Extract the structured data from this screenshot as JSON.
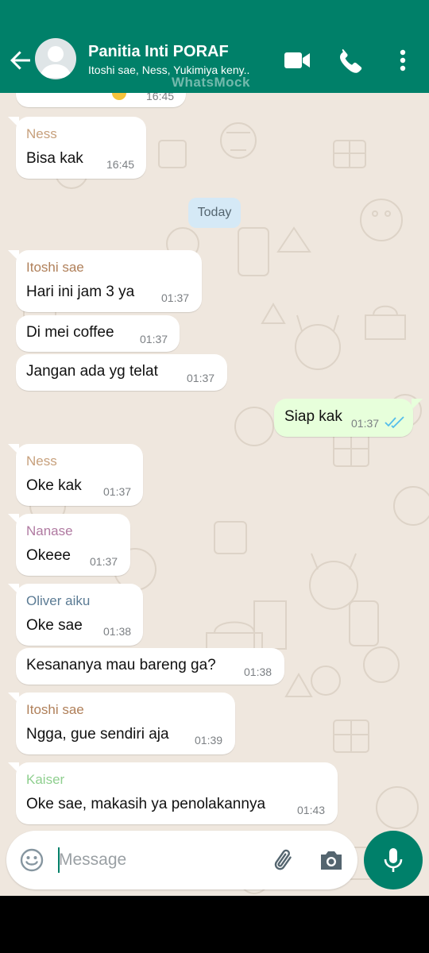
{
  "header": {
    "title": "Panitia Inti PORAF",
    "subtitle": "Itoshi sae, Ness, Yukimiya keny..",
    "watermark": "WhatsMock",
    "back_icon": "arrow-left-icon",
    "icons": [
      "video-call-icon",
      "phone-icon",
      "more-vertical-icon"
    ]
  },
  "colors": {
    "header": "#008069",
    "chat_bg": "#efe7de",
    "outgoing_bubble": "#e7ffdb",
    "date_pill": "#d5e9f6",
    "read_ticks": "#53bdeb"
  },
  "date_separator": "Today",
  "messages": [
    {
      "sender": "",
      "text": "",
      "time": "16:45",
      "direction": "in"
    },
    {
      "sender": "Ness",
      "text": "Bisa kak",
      "time": "16:45",
      "direction": "in"
    },
    {
      "sender": "Itoshi sae",
      "text": "Hari ini jam 3 ya",
      "time": "01:37",
      "direction": "in"
    },
    {
      "sender": "",
      "text": "Di mei coffee",
      "time": "01:37",
      "direction": "in"
    },
    {
      "sender": "",
      "text": "Jangan ada yg telat",
      "time": "01:37",
      "direction": "in"
    },
    {
      "sender": "",
      "text": "Siap kak",
      "time": "01:37",
      "direction": "out",
      "status": "read"
    },
    {
      "sender": "Ness",
      "text": "Oke kak",
      "time": "01:37",
      "direction": "in"
    },
    {
      "sender": "Nanase",
      "text": "Okeee",
      "time": "01:37",
      "direction": "in"
    },
    {
      "sender": "Oliver aiku",
      "text": "Oke sae",
      "time": "01:38",
      "direction": "in"
    },
    {
      "sender": "",
      "text": "Kesananya mau bareng ga?",
      "time": "01:38",
      "direction": "in"
    },
    {
      "sender": "Itoshi sae",
      "text": "Ngga, gue sendiri aja",
      "time": "01:39",
      "direction": "in"
    },
    {
      "sender": "Kaiser",
      "text": "Oke sae, makasih ya penolakannya",
      "time": "01:43",
      "direction": "in"
    }
  ],
  "sender_colors": {
    "Ness": "#c7a07c",
    "Itoshi sae": "#b0805a",
    "Nanase": "#b07aa1",
    "Oliver aiku": "#5b7b94",
    "Kaiser": "#8fcf8f"
  },
  "input": {
    "placeholder": "Message",
    "value": "",
    "icons": [
      "emoji-icon",
      "attach-icon",
      "camera-icon",
      "microphone-icon"
    ]
  }
}
